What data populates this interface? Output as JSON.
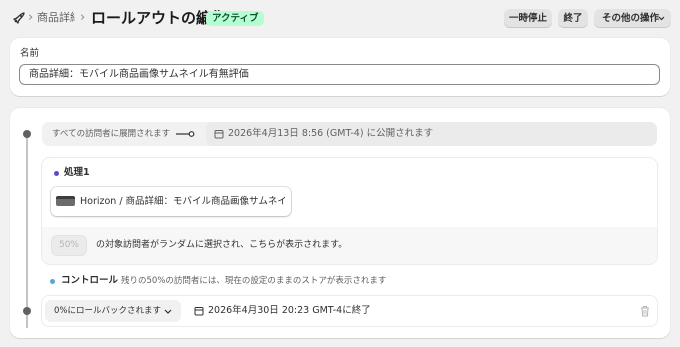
{
  "header": {
    "breadcrumb_separator": "›",
    "breadcrumb_parent": "商品詳細：モバイル商品画像サムネイル有無評価",
    "title": "ロールアウトの編集",
    "status_badge": "アクティブ",
    "actions": {
      "pause": "一時停止",
      "end": "終了",
      "more": "その他の操作"
    }
  },
  "name_section": {
    "label": "名前",
    "value": "商品詳細：モバイル商品画像サムネイル有無評価"
  },
  "timeline": {
    "start": {
      "expand_label": "すべての訪問者に展開されます",
      "publish_text": "2026年4月13日 8:56 (GMT-4) に公開されます"
    },
    "treatment": {
      "title": "処理1",
      "theme_name": "Horizon / 商品詳細：モバイル商品画像サムネイル有無評価",
      "percent": "50%",
      "percent_description": "の対象訪問者がランダムに選択され、こちらが表示されます。",
      "dot_color": "#5a4ad1"
    },
    "control": {
      "title": "コントロール",
      "description": "残りの50%の訪問者には、現在の設定のままのストアが表示されます",
      "dot_color": "#52a8d8"
    },
    "end": {
      "rollback_option": "0%にロールバックされます",
      "end_text": "2026年4月30日 20:23 GMT-4に終了"
    }
  },
  "colors": {
    "badge_bg": "#b4fed2",
    "badge_text": "#0c5132"
  }
}
